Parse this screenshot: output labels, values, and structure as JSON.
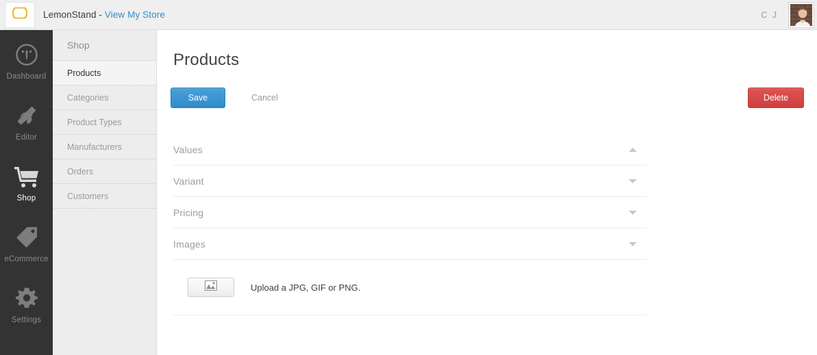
{
  "header": {
    "logo_icon": "lemonstand-logo-icon",
    "logo_color": "#e8bf3f",
    "brand_name": "LemonStand - ",
    "store_link": "View My Store",
    "user_initials": "C J",
    "avatar_alt": "user-avatar"
  },
  "rail": {
    "items": [
      {
        "label": "Dashboard",
        "icon": "dashboard-gauge-icon",
        "active": false
      },
      {
        "label": "Editor",
        "icon": "editor-tools-icon",
        "active": false
      },
      {
        "label": "Shop",
        "icon": "shopping-cart-icon",
        "active": true
      },
      {
        "label": "eCommerce",
        "icon": "price-tag-icon",
        "active": false
      },
      {
        "label": "Settings",
        "icon": "gear-icon",
        "active": false
      }
    ]
  },
  "subnav": {
    "title": "Shop",
    "items": [
      {
        "label": "Products",
        "active": true
      },
      {
        "label": "Categories",
        "active": false
      },
      {
        "label": "Product Types",
        "active": false
      },
      {
        "label": "Manufacturers",
        "active": false
      },
      {
        "label": "Orders",
        "active": false
      },
      {
        "label": "Customers",
        "active": false
      }
    ]
  },
  "main": {
    "page_title": "Products",
    "save_label": "Save",
    "cancel_label": "Cancel",
    "delete_label": "Delete",
    "save_color": "#2f8ccb",
    "delete_color": "#cf403f",
    "sections": [
      {
        "label": "Values",
        "expanded": true,
        "chevron": "chevron-up-icon"
      },
      {
        "label": "Variant",
        "expanded": false,
        "chevron": "chevron-down-icon"
      },
      {
        "label": "Pricing",
        "expanded": false,
        "chevron": "chevron-down-icon"
      },
      {
        "label": "Images",
        "expanded": false,
        "chevron": "chevron-down-icon"
      }
    ],
    "upload": {
      "button_icon": "picture-icon",
      "text": "Upload a JPG, GIF or PNG."
    }
  }
}
